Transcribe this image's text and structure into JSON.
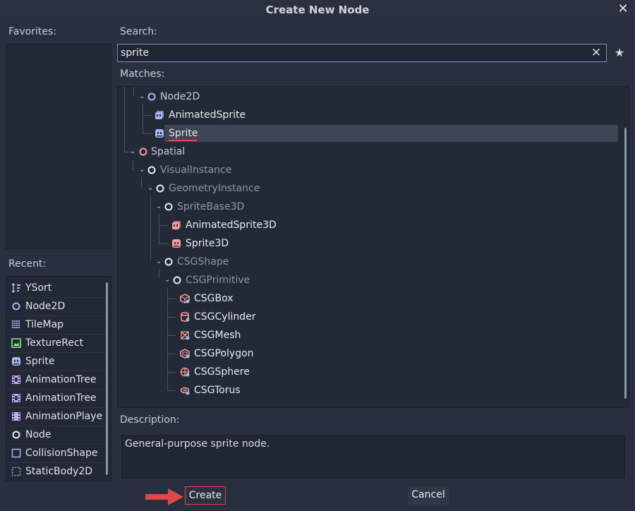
{
  "dialog": {
    "title": "Create New Node"
  },
  "favorites": {
    "label": "Favorites:"
  },
  "search": {
    "label": "Search:",
    "value": "sprite"
  },
  "matches": {
    "label": "Matches:",
    "items": [
      {
        "label": "Node2D",
        "icon": "circle-outline-icon",
        "color": "#a5b7f3"
      },
      {
        "label": "AnimatedSprite",
        "icon": "animated-sprite-icon",
        "color": "#a5b7f3"
      },
      {
        "label": "Sprite",
        "icon": "sprite-icon",
        "color": "#a5b7f3",
        "selected": true
      },
      {
        "label": "Spatial",
        "icon": "circle-outline-icon",
        "color": "#fc9c9c"
      },
      {
        "label": "VisualInstance",
        "icon": "circle-outline-icon",
        "dim": true
      },
      {
        "label": "GeometryInstance",
        "icon": "circle-outline-icon",
        "dim": true
      },
      {
        "label": "SpriteBase3D",
        "icon": "circle-outline-icon",
        "dim": true
      },
      {
        "label": "AnimatedSprite3D",
        "icon": "animated-sprite-3d-icon",
        "color": "#fc9c9c"
      },
      {
        "label": "Sprite3D",
        "icon": "sprite-3d-icon",
        "color": "#fc9c9c"
      },
      {
        "label": "CSGShape",
        "icon": "circle-outline-icon",
        "dim": true
      },
      {
        "label": "CSGPrimitive",
        "icon": "circle-outline-icon",
        "dim": true
      },
      {
        "label": "CSGBox",
        "icon": "csg-box-icon",
        "color": "#fc9c9c"
      },
      {
        "label": "CSGCylinder",
        "icon": "csg-cylinder-icon",
        "color": "#fc9c9c"
      },
      {
        "label": "CSGMesh",
        "icon": "csg-mesh-icon",
        "color": "#fc9c9c"
      },
      {
        "label": "CSGPolygon",
        "icon": "csg-polygon-icon",
        "color": "#fc9c9c"
      },
      {
        "label": "CSGSphere",
        "icon": "csg-sphere-icon",
        "color": "#fc9c9c"
      },
      {
        "label": "CSGTorus",
        "icon": "csg-torus-icon",
        "color": "#fc9c9c"
      }
    ]
  },
  "recent": {
    "label": "Recent:",
    "items": [
      {
        "label": "YSort",
        "icon": "ysort-icon"
      },
      {
        "label": "Node2D",
        "icon": "circle-outline-icon"
      },
      {
        "label": "TileMap",
        "icon": "tilemap-icon"
      },
      {
        "label": "TextureRect",
        "icon": "texture-rect-icon"
      },
      {
        "label": "Sprite",
        "icon": "sprite-icon"
      },
      {
        "label": "AnimationTree",
        "icon": "animation-tree-icon"
      },
      {
        "label": "AnimationTree",
        "icon": "animation-tree-icon"
      },
      {
        "label": "AnimationPlaye",
        "icon": "animation-player-icon"
      },
      {
        "label": "Node",
        "icon": "circle-outline-icon"
      },
      {
        "label": "CollisionShape",
        "icon": "collision-shape-icon"
      },
      {
        "label": "StaticBody2D",
        "icon": "static-body-2d-icon"
      }
    ]
  },
  "description": {
    "label": "Description:",
    "text": "General-purpose sprite node."
  },
  "buttons": {
    "create": "Create",
    "cancel": "Cancel"
  },
  "colors": {
    "accent_2d": "#a5b7f3",
    "accent_3d": "#fc9c9c",
    "highlight_red": "#e04848"
  }
}
